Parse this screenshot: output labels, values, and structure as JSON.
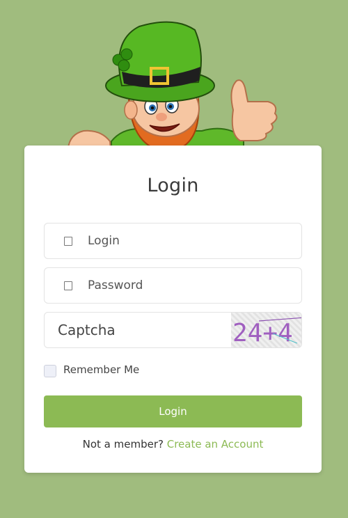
{
  "form": {
    "title": "Login",
    "login_placeholder": "Login",
    "password_placeholder": "Password",
    "captcha_placeholder": "Captcha",
    "captcha_text": "24+4",
    "remember_label": "Remember Me",
    "submit_label": "Login",
    "signup_prompt": "Not a member?",
    "signup_link": "Create an Account"
  },
  "colors": {
    "page_background": "#a0bc7e",
    "accent": "#8cba54",
    "card": "#ffffff"
  },
  "icons": {
    "login": "user-icon",
    "password": "lock-icon"
  }
}
